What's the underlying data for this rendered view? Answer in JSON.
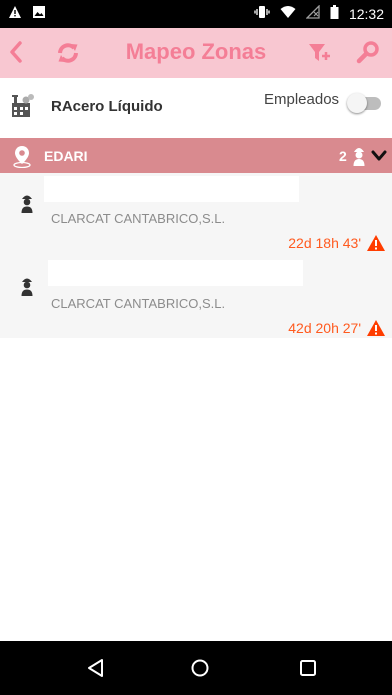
{
  "status_bar": {
    "time": "12:32",
    "icons": [
      "alert-icon",
      "image-icon",
      "vibrate-icon",
      "wifi-icon",
      "no-signal-icon",
      "battery-icon"
    ]
  },
  "app_bar": {
    "title": "Mapeo Zonas",
    "accent_color": "#f47e96",
    "background": "#f8c7d1",
    "icons": [
      "back-icon",
      "refresh-icon",
      "filter-icon",
      "search-icon"
    ]
  },
  "subheader": {
    "title": "RAcero Líquido",
    "toggle_label": "Empleados",
    "toggle_on": false
  },
  "zone": {
    "name": "EDARI",
    "count": "2",
    "background": "#d98a8f"
  },
  "workers": [
    {
      "name": "",
      "company": "CLARCAT CANTABRICO,S.L.",
      "duration": "22d 18h 43'"
    },
    {
      "name": "",
      "company": "CLARCAT CANTABRICO,S.L.",
      "duration": "42d 20h 27'"
    }
  ],
  "nav_bar": {
    "icons": [
      "back-triangle-icon",
      "home-circle-icon",
      "recents-square-icon"
    ]
  }
}
